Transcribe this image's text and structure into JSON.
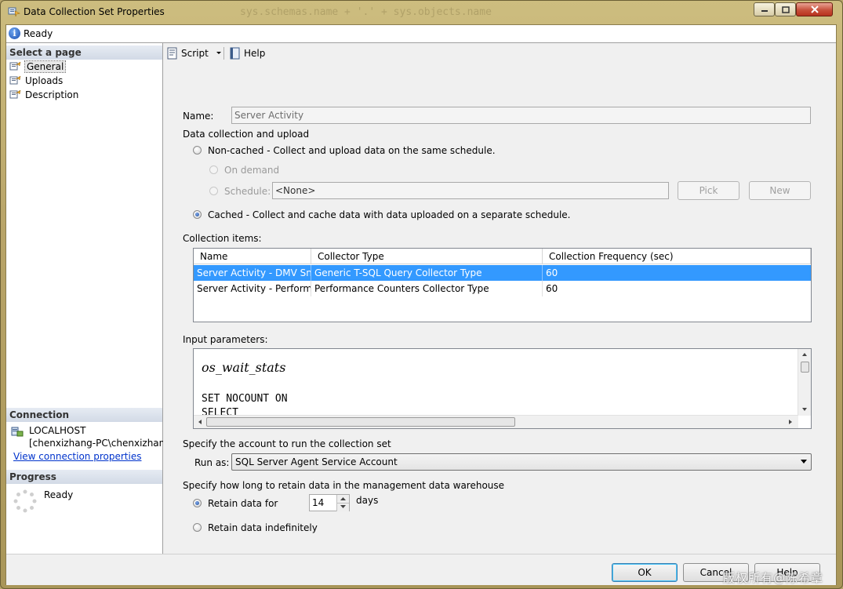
{
  "window": {
    "title": "Data Collection Set Properties",
    "ghost_text": "sys.schemas.name + '.' + sys.objects.name"
  },
  "status": {
    "text": "Ready"
  },
  "left_panel": {
    "select_page_header": "Select a page",
    "pages": [
      {
        "label": "General",
        "icon": "page-settings-icon",
        "selected": true
      },
      {
        "label": "Uploads",
        "icon": "page-settings-icon",
        "selected": false
      },
      {
        "label": "Description",
        "icon": "page-settings-icon",
        "selected": false
      }
    ],
    "connection_header": "Connection",
    "server": "LOCALHOST",
    "user": "[chenxizhang-PC\\chenxizhang",
    "connection_link": "View connection properties",
    "progress_header": "Progress",
    "progress_status": "Ready"
  },
  "toolbar": {
    "script_label": "Script",
    "help_label": "Help"
  },
  "form": {
    "name_label": "Name:",
    "name_value": "Server Activity",
    "data_collection_label": "Data collection and upload",
    "noncached_label": "Non-cached - Collect and upload data on the same schedule.",
    "on_demand_label": "On demand",
    "schedule_label": "Schedule:",
    "schedule_value": "<None>",
    "pick_label": "Pick",
    "new_label": "New",
    "cached_label": "Cached - Collect and cache data with data uploaded on a separate schedule.",
    "collection_items_label": "Collection items:",
    "columns": [
      "Name",
      "Collector Type",
      "Collection Frequency (sec)"
    ],
    "rows": [
      {
        "name": "Server Activity - DMV Sn...",
        "type": "Generic T-SQL Query Collector Type",
        "freq": "60",
        "selected": true
      },
      {
        "name": "Server Activity - Perform...",
        "type": "Performance Counters Collector Type",
        "freq": "60",
        "selected": false
      }
    ],
    "input_params_label": "Input parameters:",
    "input_params_lines": [
      "os_wait_stats",
      "",
      "SET NOCOUNT ON",
      "SELECT"
    ],
    "account_section_label": "Specify the account to run the collection set",
    "run_as_label": "Run as:",
    "run_as_value": "SQL Server Agent Service Account",
    "retain_section_label": "Specify how long to retain data in the management data warehouse",
    "retain_for_label": "Retain data for",
    "retain_days_value": "14",
    "days_label": "days",
    "retain_indef_label": "Retain data indefinitely",
    "retain_mode": "days"
  },
  "buttons": {
    "ok": "OK",
    "cancel": "Cancel",
    "help": "Help"
  },
  "watermark": "版权所有@陈希章",
  "colors": {
    "selection": "#3399ff",
    "link": "#0033cc",
    "frame": "#b8a468"
  }
}
